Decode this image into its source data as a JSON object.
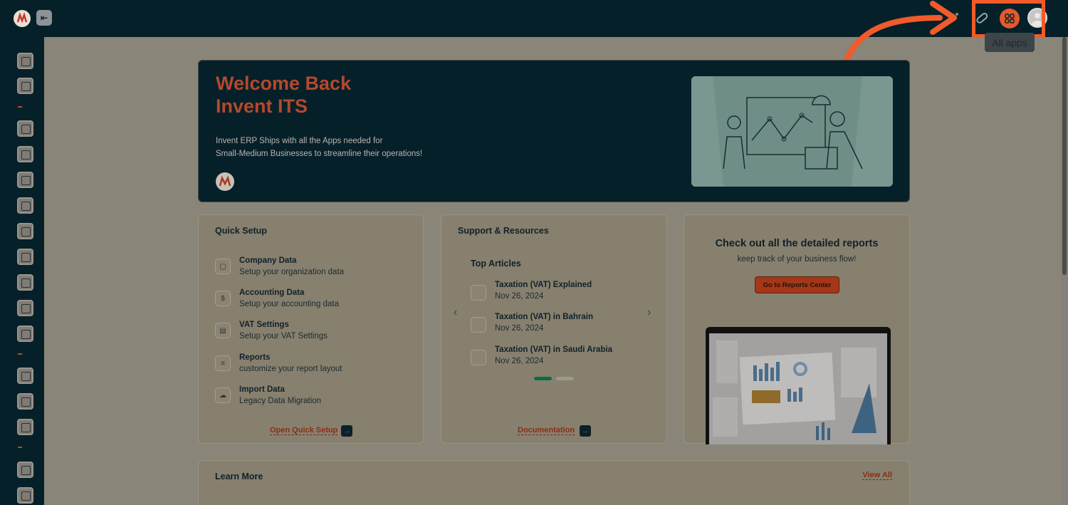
{
  "header": {
    "tooltip": "All apps"
  },
  "icons": {
    "logo": "company-logo",
    "collapse": "collapse-sidebar-icon",
    "magic": "magic-wand-icon",
    "pill": "pill-icon",
    "apps": "grid-apps-icon",
    "avatar": "user-avatar"
  },
  "colors": {
    "brand_dark": "#06202a",
    "accent": "#e25a2e",
    "highlight": "#f15a2b"
  },
  "hero": {
    "title_line1": "Welcome Back",
    "title_line2": "Invent ITS",
    "text_line1": "Invent ERP Ships with all the Apps needed for",
    "text_line2": "Small-Medium Businesses to streamline their operations!"
  },
  "quick_setup": {
    "title": "Quick Setup",
    "items": [
      {
        "name": "Company Data",
        "desc": "Setup your organization data"
      },
      {
        "name": "Accounting Data",
        "desc": "Setup your accounting data"
      },
      {
        "name": "VAT Settings",
        "desc": "Setup your VAT Settings"
      },
      {
        "name": "Reports",
        "desc": "customize your report layout"
      },
      {
        "name": "Import Data",
        "desc": "Legacy Data Migration"
      }
    ],
    "link": "Open Quick Setup"
  },
  "support": {
    "title": "Support & Resources",
    "top_articles": "Top Articles",
    "articles": [
      {
        "title": "Taxation (VAT) Explained",
        "date": "Nov 26, 2024"
      },
      {
        "title": "Taxation (VAT) in Bahrain",
        "date": "Nov 26, 2024"
      },
      {
        "title": "Taxation (VAT) in Saudi Arabia",
        "date": "Nov 26, 2024"
      }
    ],
    "link": "Documentation"
  },
  "reports": {
    "title": "Check out all the detailed reports",
    "subtitle": "keep track of your business flow!",
    "button": "Go to Reports Center"
  },
  "learn_more": {
    "title": "Learn More",
    "view_all": "View All"
  }
}
